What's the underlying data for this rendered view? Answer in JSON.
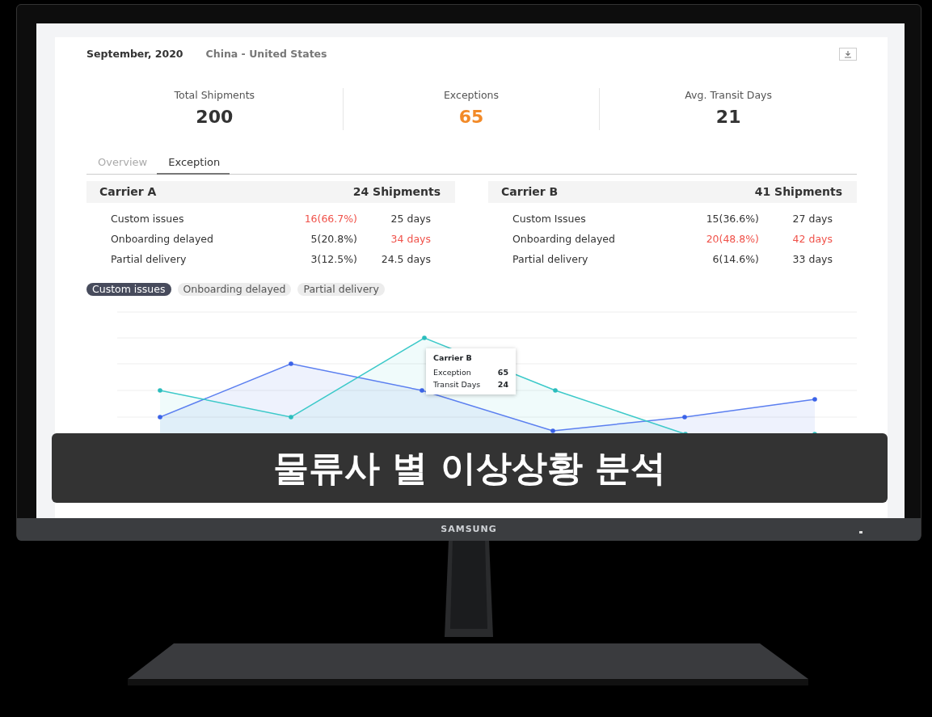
{
  "report": {
    "period": "September, 2020",
    "route": "China - United States"
  },
  "stats": [
    {
      "label": "Total Shipments",
      "value": "200",
      "kind": "plain"
    },
    {
      "label": "Exceptions",
      "value": "65",
      "kind": "alert"
    },
    {
      "label": "Avg. Transit Days",
      "value": "21",
      "kind": "plain"
    }
  ],
  "tabs": [
    {
      "label": "Overview",
      "selected": false
    },
    {
      "label": "Exception",
      "selected": true
    }
  ],
  "carriers": [
    {
      "name": "Carrier A",
      "total": "24 Shipments",
      "rows": [
        {
          "issue": "Custom issues",
          "count": "16(66.7%)",
          "count_highlight": true,
          "days": "25 days",
          "days_highlight": false
        },
        {
          "issue": "Onboarding delayed",
          "count": "5(20.8%)",
          "count_highlight": false,
          "days": "34 days",
          "days_highlight": true
        },
        {
          "issue": "Partial delivery",
          "count": "3(12.5%)",
          "count_highlight": false,
          "days": "24.5 days",
          "days_highlight": false
        }
      ]
    },
    {
      "name": "Carrier B",
      "total": "41 Shipments",
      "rows": [
        {
          "issue": "Custom Issues",
          "count": "15(36.6%)",
          "count_highlight": false,
          "days": "27 days",
          "days_highlight": false
        },
        {
          "issue": "Onboarding delayed",
          "count": "20(48.8%)",
          "count_highlight": true,
          "days": "42 days",
          "days_highlight": true
        },
        {
          "issue": "Partial delivery",
          "count": "6(14.6%)",
          "count_highlight": false,
          "days": "33 days",
          "days_highlight": false
        }
      ]
    }
  ],
  "filters": [
    {
      "label": "Custom issues",
      "selected": true
    },
    {
      "label": "Onboarding delayed",
      "selected": false
    },
    {
      "label": "Partial delivery",
      "selected": false
    }
  ],
  "tooltip": {
    "title": "Carrier B",
    "rows": [
      {
        "label": "Exception",
        "value": "65"
      },
      {
        "label": "Transit Days",
        "value": "24"
      }
    ]
  },
  "caption": "물류사 별 이상상황 분석",
  "monitor": {
    "brand": "SAMSUNG"
  }
}
